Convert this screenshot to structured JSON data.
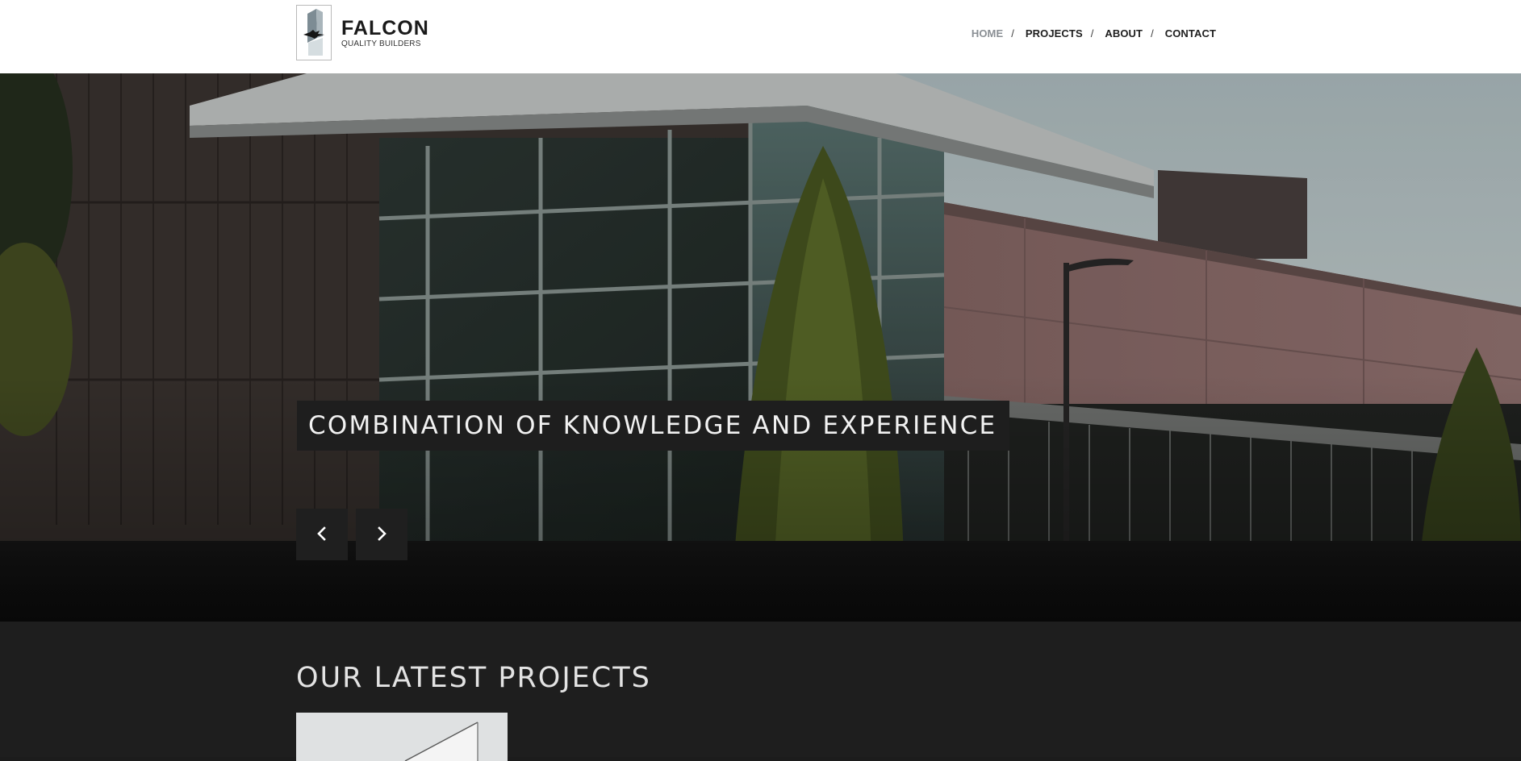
{
  "brand": {
    "name": "FALCON",
    "tagline": "QUALITY BUILDERS"
  },
  "nav": {
    "items": [
      {
        "label": "HOME",
        "active": true,
        "separator": "/"
      },
      {
        "label": "PROJECTS",
        "active": false,
        "separator": "/"
      },
      {
        "label": "ABOUT",
        "active": false,
        "separator": "/"
      },
      {
        "label": "CONTACT",
        "active": false,
        "separator": ""
      }
    ]
  },
  "hero": {
    "caption": "COMBINATION OF KNOWLEDGE AND EXPERIENCE",
    "prev_icon": "chevron-left-icon",
    "next_icon": "chevron-right-icon"
  },
  "projects": {
    "title": "OUR LATEST PROJECTS"
  },
  "colors": {
    "header_bg": "#ffffff",
    "nav_active": "#8a8f94",
    "nav_text": "#1e1e1e",
    "dark_bg": "#1e1e1e",
    "caption_text": "#f2f2f2"
  }
}
